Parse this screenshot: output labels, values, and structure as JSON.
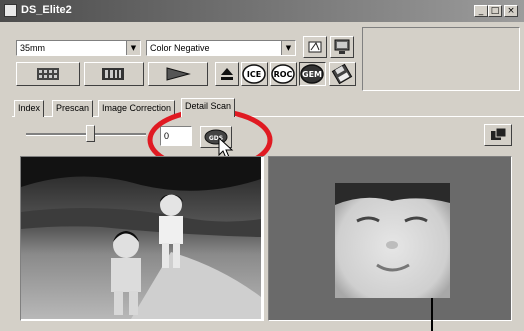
{
  "window": {
    "title": "DS_Elite2",
    "controls": [
      "_",
      "□",
      "×"
    ]
  },
  "toolbar": {
    "film_format": "35mm",
    "film_type": "Color Negative",
    "icons": {
      "index_scan": "film-strip-icon",
      "prescan": "prescan-icon",
      "scan": "scan-icon",
      "eject": "eject-icon",
      "ice": "ICE",
      "roc": "ROC",
      "gem": "GEM",
      "save": "diskette-icon",
      "preferences": "preferences-icon",
      "settings": "monitor-icon"
    }
  },
  "tabs": [
    "Index",
    "Prescan",
    "Image Correction",
    "Detail Scan"
  ],
  "controls": {
    "zoom_value": "0",
    "grain_dissolver": "GDS"
  },
  "colors": {
    "annotation": "#e01a22",
    "window": "#d4d0c8",
    "preview_bg": "#6a6a6a"
  }
}
